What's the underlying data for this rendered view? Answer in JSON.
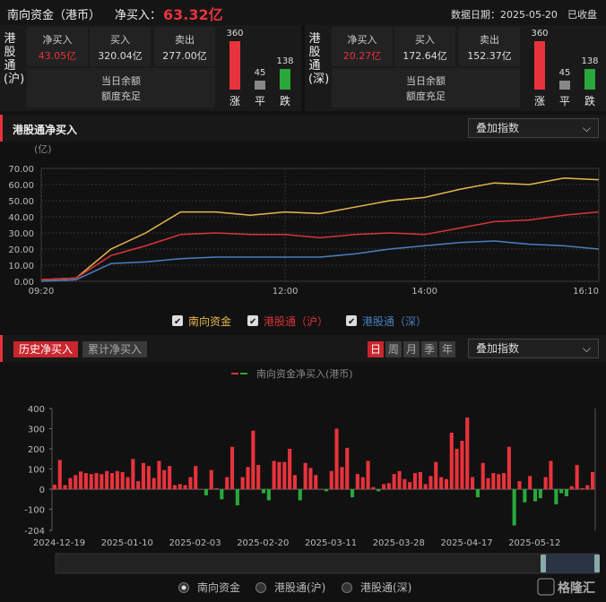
{
  "header": {
    "title": "南向资金（港币）",
    "net_label": "净买入：",
    "net_value": "63.32亿",
    "date": "数据日期：2025-05-20",
    "status": "已收盘"
  },
  "panels": [
    {
      "name": "港股通(沪)",
      "vchars": [
        "港",
        "股",
        "通",
        "(沪)"
      ],
      "net_label": "净买入",
      "net_value": "43.05亿",
      "buy_label": "买入",
      "buy_value": "320.04亿",
      "sell_label": "卖出",
      "sell_value": "277.00亿",
      "balance_label": "当日余额",
      "balance_value": "额度充足",
      "up": {
        "label": "涨",
        "count": 360
      },
      "flat": {
        "label": "平",
        "count": 45
      },
      "down": {
        "label": "跌",
        "count": 138
      }
    },
    {
      "name": "港股通(深)",
      "vchars": [
        "港",
        "股",
        "通",
        "(深)"
      ],
      "net_label": "净买入",
      "net_value": "20.27亿",
      "buy_label": "买入",
      "buy_value": "172.64亿",
      "sell_label": "卖出",
      "sell_value": "152.37亿",
      "balance_label": "当日余额",
      "balance_value": "额度充足",
      "up": {
        "label": "涨",
        "count": 360
      },
      "flat": {
        "label": "平",
        "count": 45
      },
      "down": {
        "label": "跌",
        "count": 138
      }
    }
  ],
  "section1": {
    "title": "港股通净买入",
    "dropdown": "叠加指数",
    "chevron": "chevron-down-icon"
  },
  "section2": {
    "tabs": [
      "历史净买入",
      "累计净买入"
    ],
    "period_tabs": [
      "日",
      "周",
      "月",
      "季",
      "年"
    ],
    "dropdown": "叠加指数"
  },
  "colors": {
    "south": "#e6b84c",
    "hu": "#d9343a",
    "shen": "#4a7fc1",
    "up": "#e8333c",
    "down": "#2aa83a",
    "flat": "#888888"
  },
  "chart_data": [
    {
      "type": "line",
      "ylabel": "(亿)",
      "ylim": [
        0,
        70
      ],
      "yticks": [
        0,
        10,
        20,
        30,
        40,
        50,
        60,
        70
      ],
      "xticks": [
        "09:20",
        "12:00",
        "14:00",
        "16:10"
      ],
      "x": [
        "09:20",
        "09:30",
        "09:40",
        "10:00",
        "10:30",
        "11:00",
        "11:30",
        "12:00",
        "12:30",
        "13:00",
        "13:30",
        "14:00",
        "14:30",
        "15:00",
        "15:30",
        "16:00",
        "16:10"
      ],
      "series": [
        {
          "name": "南向资金",
          "values": [
            1,
            2,
            20,
            30,
            43,
            43,
            41,
            43,
            42,
            46,
            50,
            52,
            57,
            61,
            60,
            64,
            63
          ]
        },
        {
          "name": "港股通（沪）",
          "values": [
            1,
            2,
            16,
            22,
            29,
            30,
            29,
            29,
            27,
            29,
            30,
            29,
            33,
            37,
            38,
            41,
            43
          ]
        },
        {
          "name": "港股通（深）",
          "values": [
            0,
            1,
            11,
            12,
            14,
            15,
            15,
            15,
            15,
            17,
            20,
            22,
            24,
            25,
            23,
            22,
            20
          ]
        }
      ],
      "grid": true,
      "legend": "bottom"
    },
    {
      "type": "bar",
      "legend_title": "南向资金净买入(港币)",
      "ylim": [
        -204,
        400
      ],
      "yticks": [
        -204,
        -100,
        0,
        100,
        200,
        300,
        400
      ],
      "xticks": [
        "2024-12-19",
        "2025-01-10",
        "2025-02-03",
        "2025-02-20",
        "2025-03-11",
        "2025-03-28",
        "2025-04-17",
        "2025-05-12"
      ],
      "values": [
        22,
        145,
        20,
        55,
        70,
        88,
        80,
        75,
        80,
        75,
        90,
        80,
        90,
        85,
        60,
        150,
        40,
        130,
        115,
        55,
        140,
        95,
        115,
        20,
        25,
        20,
        60,
        115,
        0,
        -30,
        95,
        5,
        -50,
        60,
        210,
        -80,
        60,
        110,
        290,
        120,
        -20,
        -55,
        140,
        135,
        135,
        200,
        70,
        -55,
        130,
        105,
        70,
        0,
        -10,
        90,
        300,
        110,
        205,
        -40,
        75,
        60,
        140,
        10,
        -10,
        25,
        30,
        75,
        90,
        50,
        35,
        80,
        85,
        25,
        65,
        135,
        60,
        50,
        280,
        200,
        240,
        355,
        60,
        -40,
        130,
        55,
        80,
        75,
        80,
        210,
        -180,
        40,
        -65,
        65,
        -60,
        -45,
        60,
        140,
        -75,
        -20,
        -35,
        15,
        120,
        5,
        20,
        85
      ],
      "legend": "bottom"
    }
  ],
  "legend1": [
    "南向资金",
    "港股通（沪）",
    "港股通（深）"
  ],
  "legend2": [
    "南向资金",
    "港股通(沪)",
    "港股通(深)"
  ],
  "watermark": "格隆汇"
}
